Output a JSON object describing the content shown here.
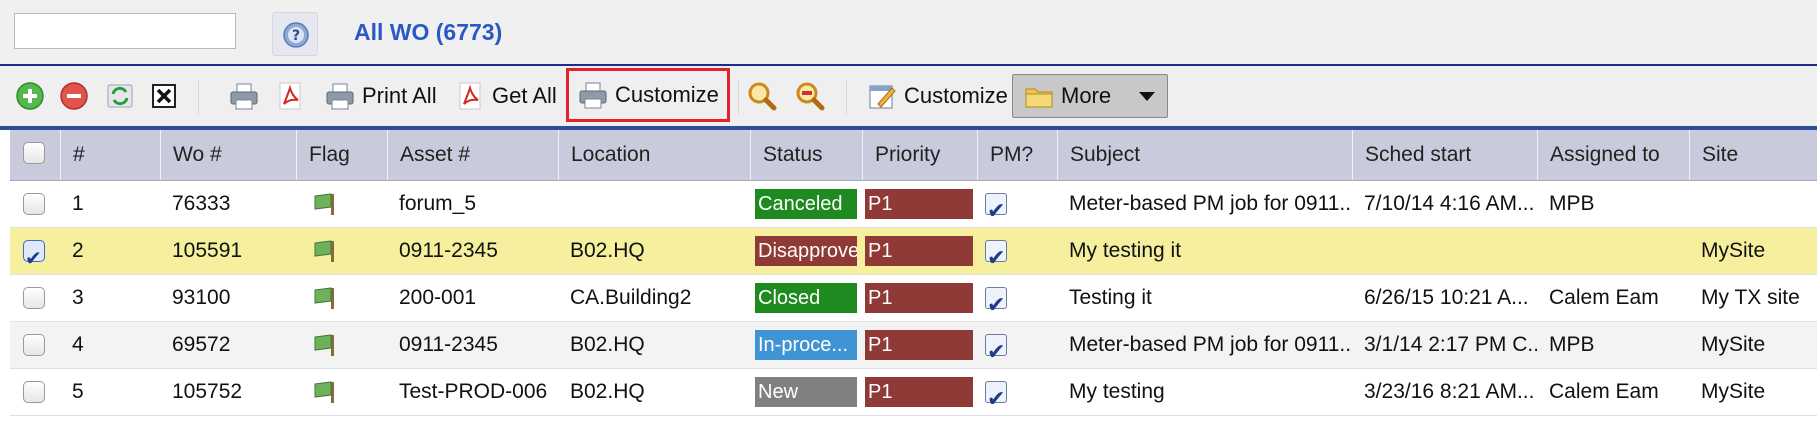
{
  "search": {
    "value": "",
    "placeholder": ""
  },
  "view": {
    "title": "All WO (6773)"
  },
  "toolbar": {
    "print_all": "Print All",
    "get_all": "Get All",
    "customize_report": "Customize",
    "customize_grid": "Customize",
    "more": "More"
  },
  "columns": {
    "num": "#",
    "wo": "Wo #",
    "flag": "Flag",
    "asset": "Asset #",
    "location": "Location",
    "status": "Status",
    "priority": "Priority",
    "pm": "PM?",
    "subject": "Subject",
    "sched": "Sched start",
    "assigned": "Assigned to",
    "site": "Site"
  },
  "rows": [
    {
      "num": "1",
      "wo": "76333",
      "asset": "forum_5",
      "location": "",
      "status": "Canceled",
      "priority": "P1",
      "subject": "Meter-based PM job for 0911...",
      "sched": "7/10/14 4:16 AM...",
      "assigned": "MPB",
      "site": ""
    },
    {
      "num": "2",
      "wo": "105591",
      "asset": "0911-2345",
      "location": "B02.HQ",
      "status": "Disapprove",
      "priority": "P1",
      "subject": "My testing it",
      "sched": "",
      "assigned": "",
      "site": "MySite"
    },
    {
      "num": "3",
      "wo": "93100",
      "asset": "200-001",
      "location": "CA.Building2",
      "status": "Closed",
      "priority": "P1",
      "subject": "Testing it",
      "sched": "6/26/15 10:21 A...",
      "assigned": "Calem Eam",
      "site": "My TX site"
    },
    {
      "num": "4",
      "wo": "69572",
      "asset": "0911-2345",
      "location": "B02.HQ",
      "status": "In-proce...",
      "priority": "P1",
      "subject": "Meter-based PM job for 0911...",
      "sched": "3/1/14 2:17 PM C...",
      "assigned": "MPB",
      "site": "MySite"
    },
    {
      "num": "5",
      "wo": "105752",
      "asset": "Test-PROD-006",
      "location": "B02.HQ",
      "status": "New",
      "priority": "P1",
      "subject": "My testing",
      "sched": "3/23/16 8:21 AM...",
      "assigned": "Calem Eam",
      "site": "MySite"
    }
  ],
  "colors": {
    "canceled": "#1f8a1f",
    "disapprove": "#8f3a36",
    "closed": "#1f8a1f",
    "inprocess": "#3f94d3",
    "new": "#808080",
    "priority": "#8f3a36",
    "accent": "#2a58c5"
  }
}
